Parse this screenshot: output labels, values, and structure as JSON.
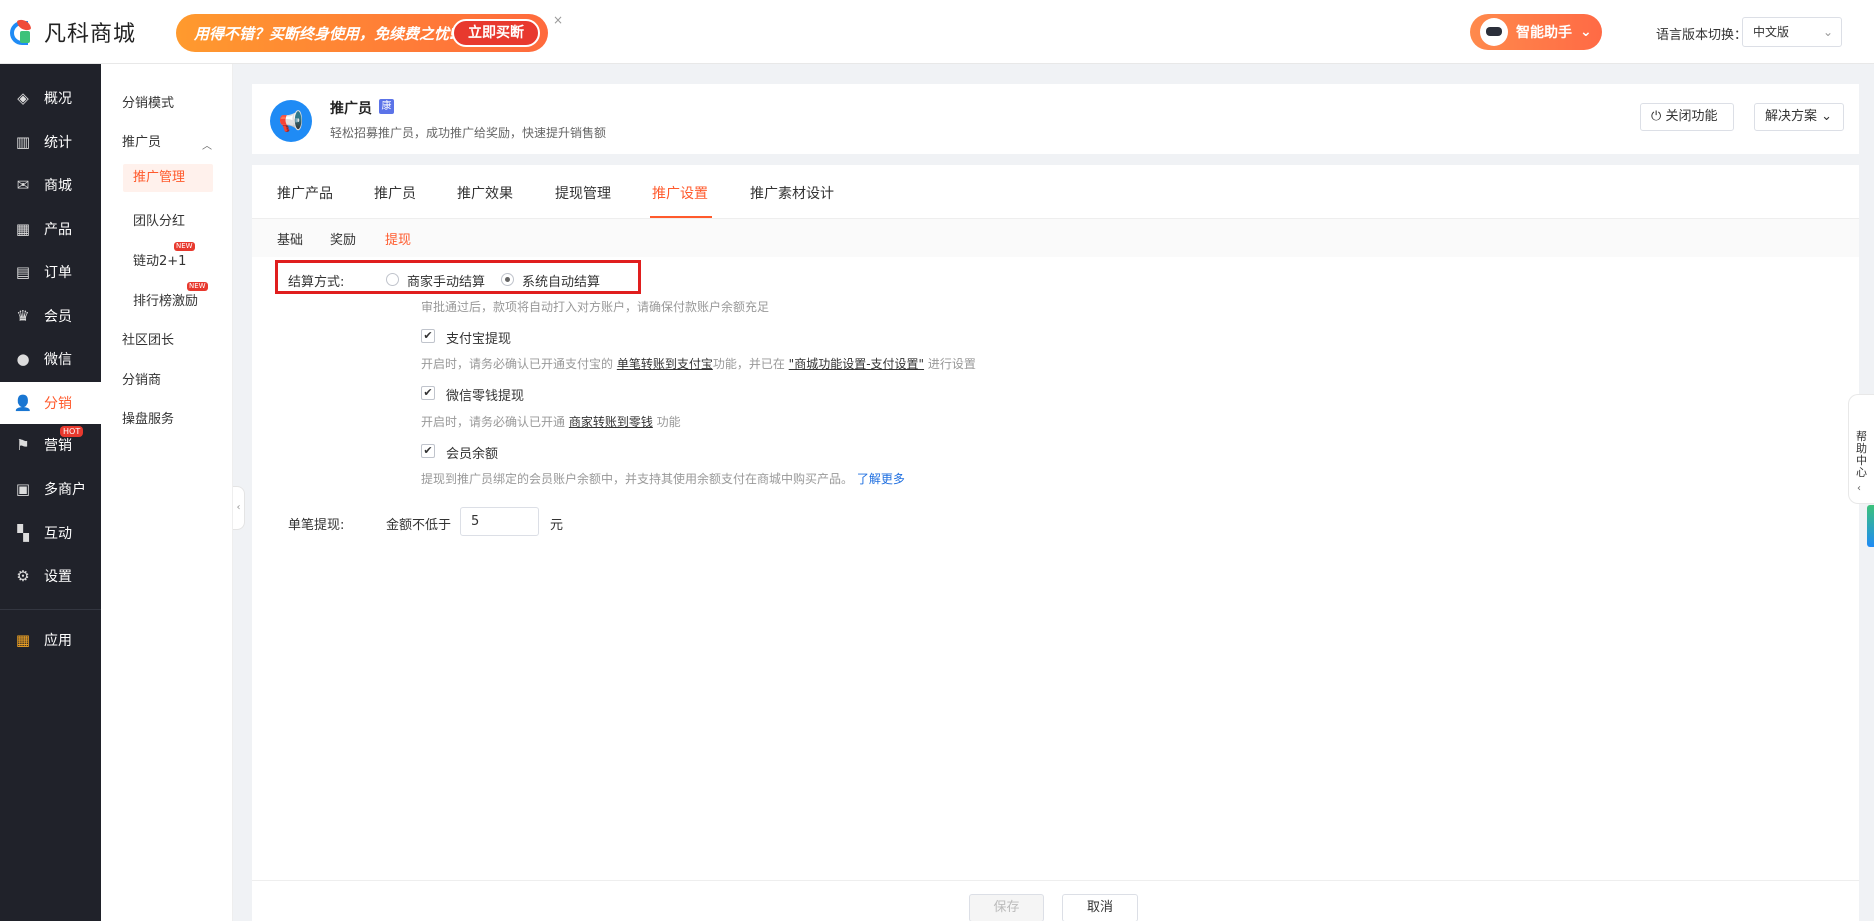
{
  "brand": {
    "logo_text": "凡科商城"
  },
  "promo": {
    "text": "用得不错？买断终身使用，免续费之忧!",
    "button": "立即买断",
    "close": "×"
  },
  "assistant": {
    "label": "智能助手",
    "chevron": "⌄"
  },
  "language": {
    "label": "语言版本切换：",
    "value": "中文版"
  },
  "main_nav": {
    "items": [
      {
        "label": "概况",
        "icon": "layers-icon"
      },
      {
        "label": "统计",
        "icon": "chart-icon"
      },
      {
        "label": "商城",
        "icon": "mail-icon"
      },
      {
        "label": "产品",
        "icon": "grid-icon"
      },
      {
        "label": "订单",
        "icon": "clipboard-icon"
      },
      {
        "label": "会员",
        "icon": "crown-icon"
      },
      {
        "label": "微信",
        "icon": "wechat-icon"
      },
      {
        "label": "分销",
        "icon": "user-icon"
      },
      {
        "label": "营销",
        "icon": "flag-icon",
        "badge": "HOT"
      },
      {
        "label": "多商户",
        "icon": "store-icon"
      },
      {
        "label": "互动",
        "icon": "interact-icon"
      },
      {
        "label": "设置",
        "icon": "gear-icon"
      },
      {
        "label": "应用",
        "icon": "apps-icon"
      }
    ]
  },
  "sub_nav": {
    "mode": "分销模式",
    "promoter": "推广员",
    "children": [
      {
        "label": "推广管理"
      },
      {
        "label": "团队分红"
      },
      {
        "label": "链动2+1",
        "badge": "NEW"
      },
      {
        "label": "排行榜激励",
        "badge": "NEW"
      }
    ],
    "community": "社区团长",
    "distributor": "分销商",
    "service": "操盘服务"
  },
  "header": {
    "title": "推广员",
    "tag": "康",
    "desc": "轻松招募推广员，成功推广给奖励，快速提升销售额",
    "close_btn": "关闭功能",
    "solution_btn": "解决方案"
  },
  "tabs": [
    "推广产品",
    "推广员",
    "推广效果",
    "提现管理",
    "推广设置",
    "推广素材设计"
  ],
  "subtabs": [
    "基础",
    "奖励",
    "提现"
  ],
  "settlement": {
    "label": "结算方式:",
    "option1": "商家手动结算",
    "option2": "系统自动结算",
    "selected": "系统自动结算",
    "hint": "审批通过后，款项将自动打入对方账户，请确保付款账户余额充足"
  },
  "alipay": {
    "label": "支付宝提现",
    "hint_pre": "开启时，请务必确认已开通支付宝的 ",
    "hint_link1": "单笔转账到支付宝",
    "hint_mid": "功能，并已在 ",
    "hint_link2": "\"商城功能设置-支付设置\"",
    "hint_post": " 进行设置"
  },
  "wechat": {
    "label": "微信零钱提现",
    "hint_pre": "开启时，请务必确认已开通 ",
    "hint_link": "商家转账到零钱",
    "hint_post": " 功能"
  },
  "balance": {
    "label": "会员余额",
    "hint": "提现到推广员绑定的会员账户余额中，并支持其使用余额支付在商城中购买产品。",
    "hint_link": "了解更多"
  },
  "single": {
    "label": "单笔提现:",
    "min_label": "金额不低于",
    "value": "5",
    "unit": "元"
  },
  "footer": {
    "save": "保存",
    "cancel": "取消"
  },
  "help": {
    "label": "帮助中心"
  }
}
